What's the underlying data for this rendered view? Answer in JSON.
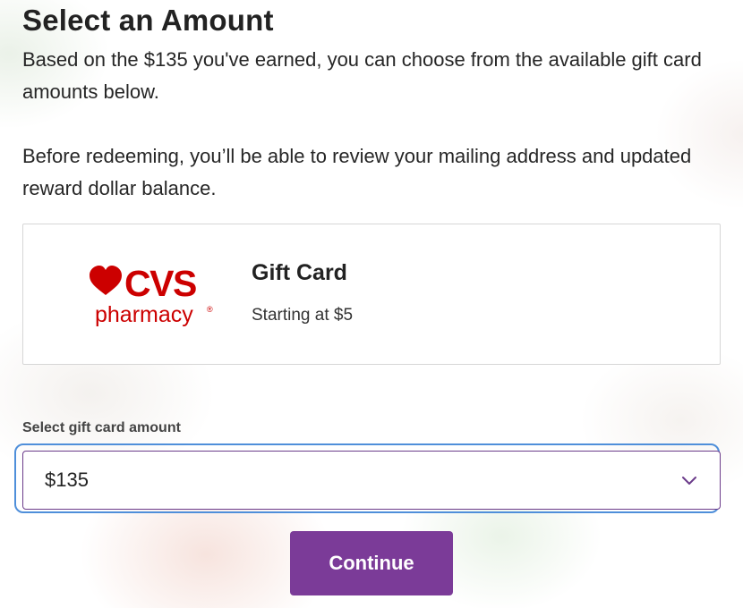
{
  "header": {
    "title": "Select an Amount"
  },
  "intro": {
    "paragraph_1": "Based on the $135 you've earned, you can choose from the available gift card amounts below.",
    "paragraph_2": "Before redeeming, you’ll be able to review your mailing address and updated reward dollar balance."
  },
  "gift_card": {
    "brand_word": "CVS",
    "brand_sub": "pharmacy",
    "brand_mark": "®",
    "title": "Gift Card",
    "subtitle": "Starting at $5",
    "brand_color": "#cc0000"
  },
  "amount_select": {
    "label": "Select gift card amount",
    "selected_value": "$135",
    "icon": "chevron-down-icon",
    "focus_color": "#4f8fda",
    "border_color": "#6b3b8a"
  },
  "actions": {
    "continue_label": "Continue",
    "button_color": "#7b3b98"
  }
}
